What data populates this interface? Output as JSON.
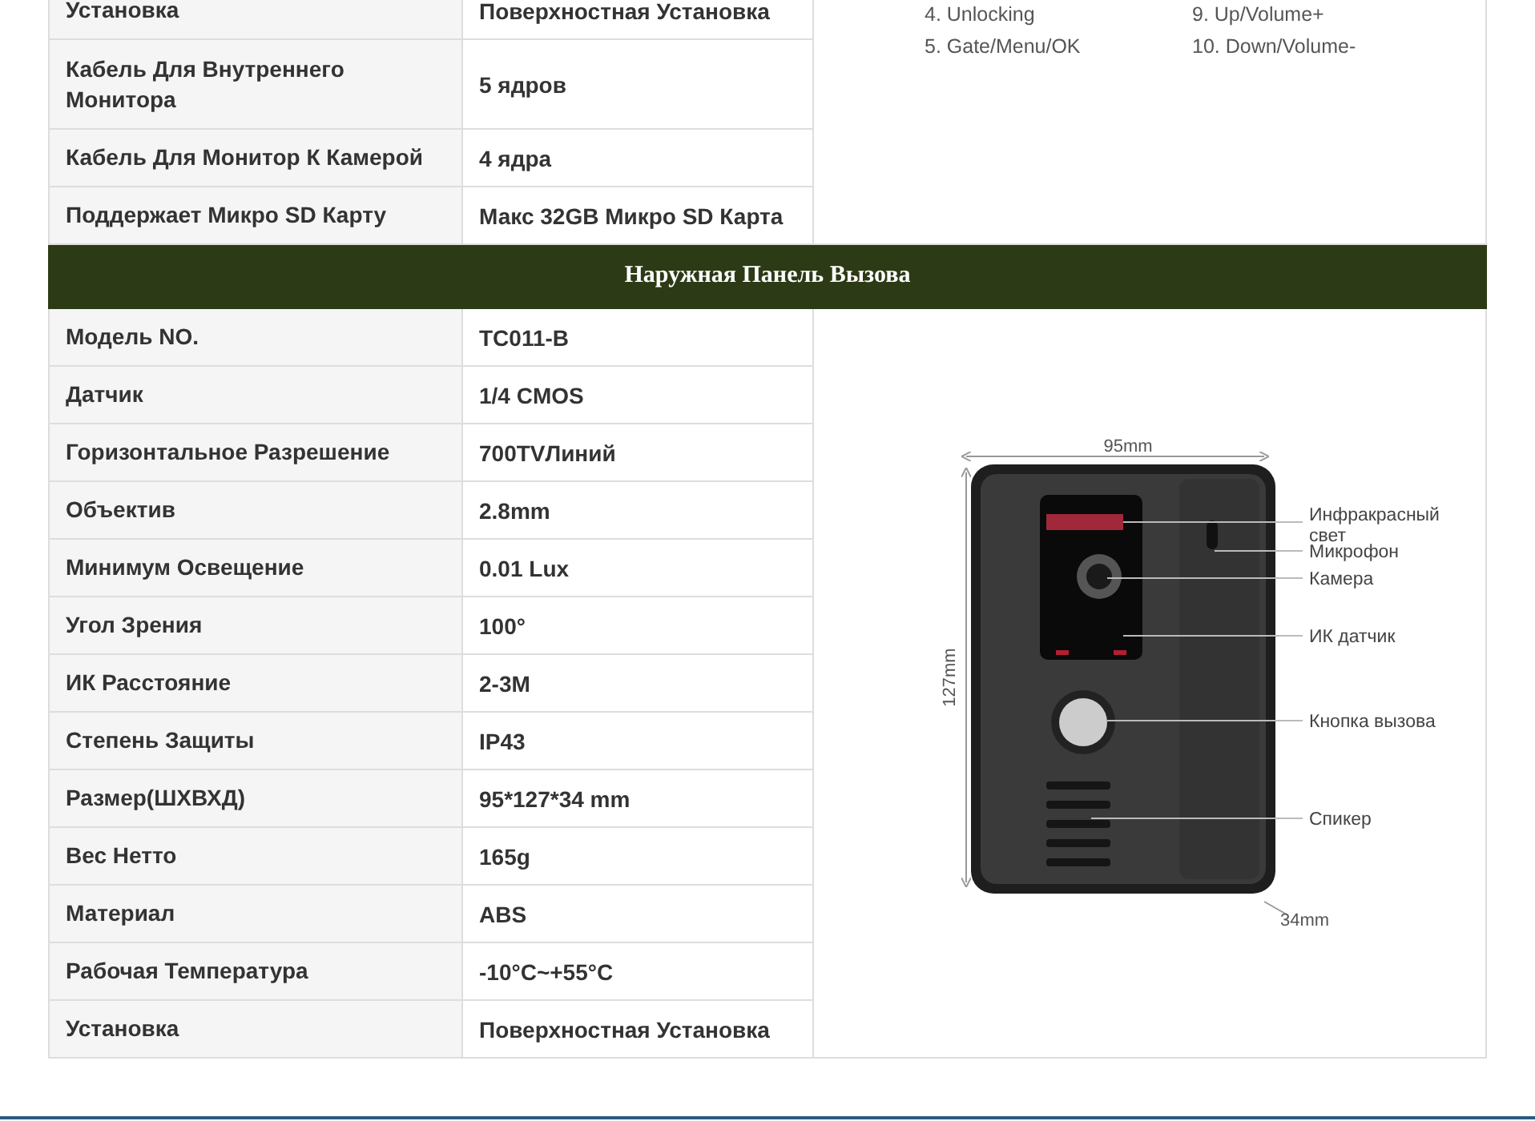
{
  "top_section": {
    "rows": [
      {
        "label": "Установка",
        "value": "Поверхностная Установка"
      },
      {
        "label": "Кабель Для Внутреннего Монитора",
        "value": "5 ядров"
      },
      {
        "label": "Кабель Для Монитор К Камерой",
        "value": "4 ядра"
      },
      {
        "label": "Поддержает Микро SD Карту",
        "value": "Макс 32GB Микро SD Карта"
      }
    ],
    "legend": [
      [
        "4. Unlocking",
        "9. Up/Volume+"
      ],
      [
        "5. Gate/Menu/OK",
        "10. Down/Volume-"
      ]
    ]
  },
  "outdoor_section": {
    "title": "Наружная Панель Вызова",
    "rows": [
      {
        "label": "Модель NO.",
        "value": "TC011-B"
      },
      {
        "label": "Датчик",
        "value": "1/4 CMOS"
      },
      {
        "label": "Горизонтальное Разрешение",
        "value": "700TVЛиний"
      },
      {
        "label": "Объектив",
        "value": "2.8mm"
      },
      {
        "label": "Минимум Освещение",
        "value": "0.01 Lux"
      },
      {
        "label": "Угол Зрения",
        "value": "100°"
      },
      {
        "label": "ИК Расстояние",
        "value": "2-3M"
      },
      {
        "label": "Степень Защиты",
        "value": "IP43"
      },
      {
        "label": "Размер(ШХВХД)",
        "value": "95*127*34 mm"
      },
      {
        "label": "Вес Нетто",
        "value": "165g"
      },
      {
        "label": "Материал",
        "value": "ABS"
      },
      {
        "label": "Рабочая Температура",
        "value": "-10°C~+55°C"
      },
      {
        "label": "Установка",
        "value": "Поверхностная Установка"
      }
    ],
    "figure": {
      "width_label": "95mm",
      "height_label": "127mm",
      "depth_label": "34mm",
      "callouts": [
        {
          "lines": [
            "Инфракрасный",
            "свет"
          ]
        },
        {
          "lines": [
            "Микрофон"
          ]
        },
        {
          "lines": [
            "Камера"
          ]
        },
        {
          "lines": [
            "ИК датчик"
          ]
        },
        {
          "lines": [
            "Кнопка вызова"
          ]
        },
        {
          "lines": [
            "Спикер"
          ]
        }
      ]
    }
  }
}
